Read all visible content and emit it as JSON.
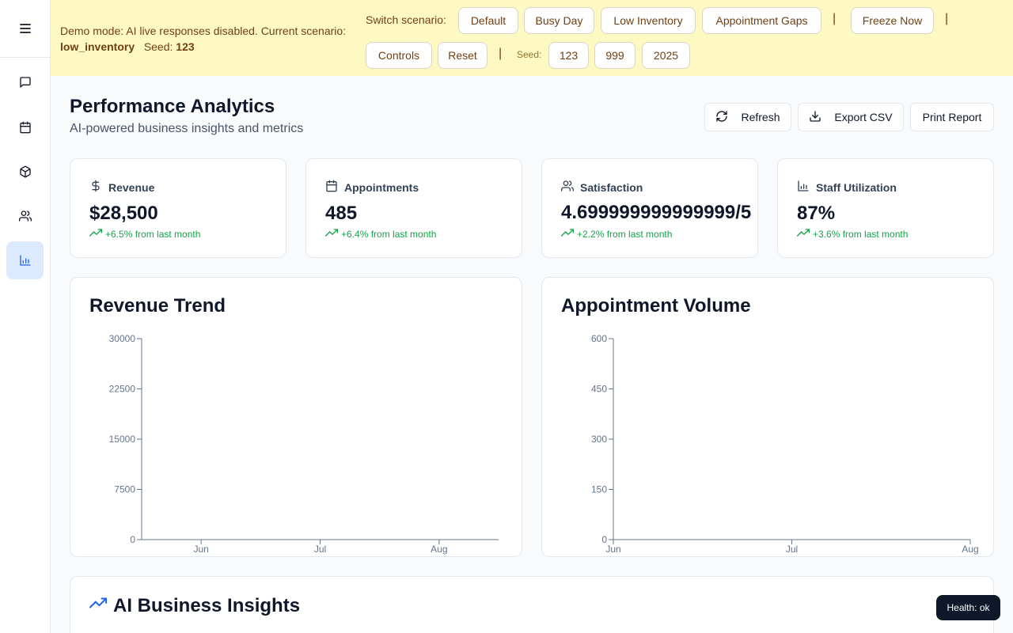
{
  "colors": {
    "accent": "#2563eb",
    "banner_bg": "#fef9c3",
    "banner_text": "#713f12",
    "positive": "#16a34a",
    "health_bg": "#0f172a"
  },
  "sidebar": {
    "menu_icon": "menu-icon",
    "items": [
      {
        "icon": "message-square-icon",
        "active": false
      },
      {
        "icon": "calendar-icon",
        "active": false
      },
      {
        "icon": "package-icon",
        "active": false
      },
      {
        "icon": "users-icon",
        "active": false
      },
      {
        "icon": "bar-chart-icon",
        "active": true
      }
    ]
  },
  "banner": {
    "text_prefix": "Demo mode: AI live responses disabled. Current scenario:",
    "scenario": "low_inventory",
    "seed_label": "Seed:",
    "seed_value": "123",
    "switch_label": "Switch scenario:",
    "scenarios": [
      "Default",
      "Busy Day",
      "Low Inventory",
      "Appointment Gaps"
    ],
    "freeze_label": "Freeze Now",
    "controls_label": "Controls",
    "reset_label": "Reset",
    "separator": "|",
    "seed_small_label": "Seed:",
    "seeds": [
      "123",
      "999",
      "2025"
    ]
  },
  "header": {
    "title": "Performance Analytics",
    "subtitle": "AI-powered business insights and metrics",
    "refresh_label": "Refresh",
    "export_label": "Export CSV",
    "print_label": "Print Report"
  },
  "metrics": [
    {
      "icon": "dollar-icon",
      "label": "Revenue",
      "value": "$28,500",
      "change": "+6.5% from last month"
    },
    {
      "icon": "calendar-icon",
      "label": "Appointments",
      "value": "485",
      "change": "+6.4% from last month"
    },
    {
      "icon": "users-icon",
      "label": "Satisfaction",
      "value": "4.699999999999999/5",
      "change": "+2.2% from last month"
    },
    {
      "icon": "bar-chart-icon",
      "label": "Staff Utilization",
      "value": "87%",
      "change": "+3.6% from last month"
    }
  ],
  "chart_data": [
    {
      "type": "line",
      "title": "Revenue Trend",
      "categories": [
        "Jun",
        "Jul",
        "Aug"
      ],
      "yticks": [
        0,
        7500,
        15000,
        22500,
        30000
      ],
      "ylim": [
        0,
        30000
      ],
      "series": [],
      "grid": false
    },
    {
      "type": "bar",
      "title": "Appointment Volume",
      "categories": [
        "Jun",
        "Jul",
        "Aug"
      ],
      "yticks": [
        0,
        150,
        300,
        450,
        600
      ],
      "ylim": [
        0,
        600
      ],
      "series": [],
      "grid": false
    }
  ],
  "insights": {
    "title": "AI Business Insights",
    "icon": "trending-up-icon"
  },
  "health": {
    "label": "Health: ok"
  }
}
